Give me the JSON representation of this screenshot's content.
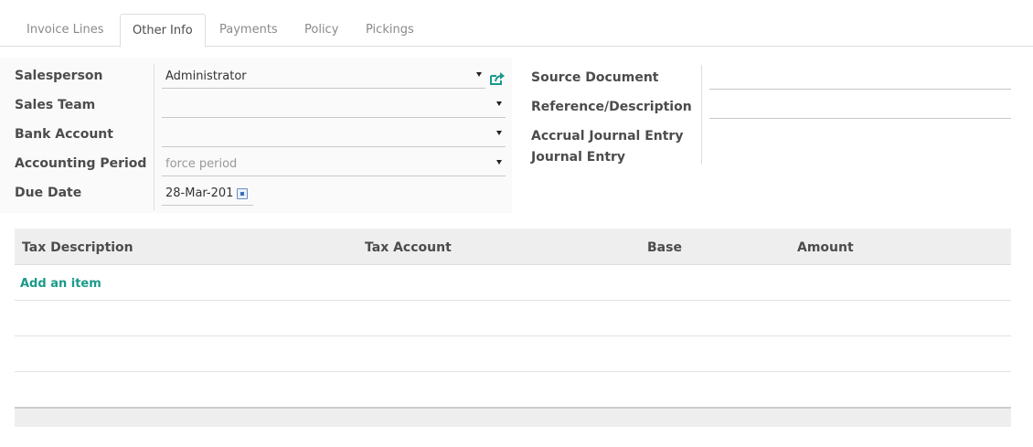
{
  "tabs": [
    {
      "label": "Invoice Lines",
      "active": false
    },
    {
      "label": "Other Info",
      "active": true
    },
    {
      "label": "Payments",
      "active": false
    },
    {
      "label": "Policy",
      "active": false
    },
    {
      "label": "Pickings",
      "active": false
    }
  ],
  "form": {
    "salesperson": {
      "label": "Salesperson",
      "value": "Administrator"
    },
    "sales_team": {
      "label": "Sales Team",
      "value": ""
    },
    "bank_account": {
      "label": "Bank Account",
      "value": ""
    },
    "accounting_period": {
      "label": "Accounting Period",
      "placeholder": "force period",
      "value": ""
    },
    "due_date": {
      "label": "Due Date",
      "value": "28-Mar-201"
    },
    "source_document": {
      "label": "Source Document",
      "value": ""
    },
    "reference": {
      "label": "Reference/Description",
      "value": ""
    },
    "accrual_journal_entry": {
      "label": "Accrual Journal Entry",
      "value": ""
    },
    "journal_entry": {
      "label": "Journal Entry",
      "value": ""
    }
  },
  "tax_table": {
    "columns": [
      "Tax Description",
      "Tax Account",
      "Base",
      "Amount"
    ],
    "add_item_label": "Add an item",
    "rows": []
  },
  "colors": {
    "accent": "#1b9a8a",
    "header_bg": "#eeeeee",
    "border": "#dddddd"
  },
  "icons": {
    "external_link": "external-link-icon",
    "calendar": "calendar-icon",
    "dropdown": "caret-down-icon"
  }
}
